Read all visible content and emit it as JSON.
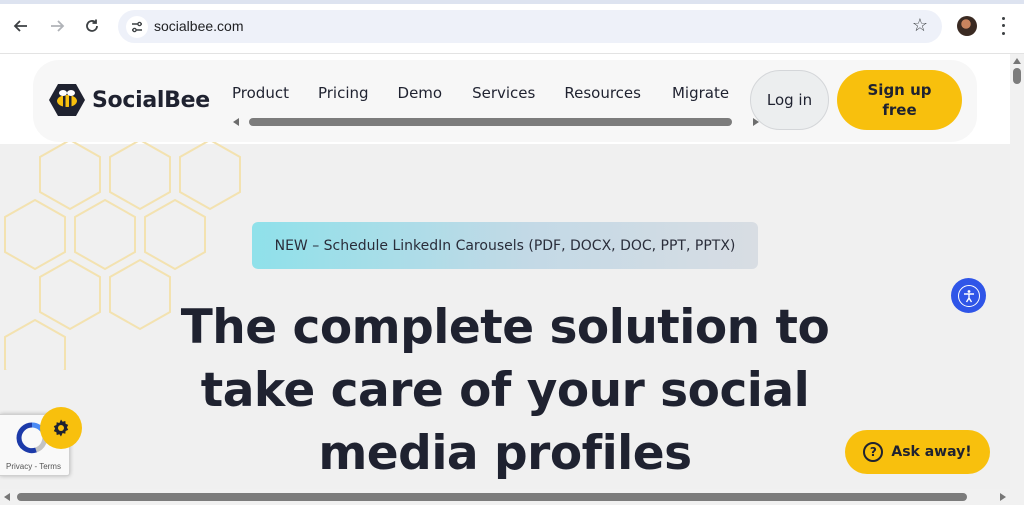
{
  "browser": {
    "url": "socialbee.com",
    "icons": [
      "back-arrow-icon",
      "forward-arrow-icon",
      "reload-icon",
      "site-info-icon",
      "bookmark-star-icon",
      "profile-avatar",
      "more-menu-icon"
    ]
  },
  "site": {
    "logo_text": "SocialBee",
    "nav": [
      {
        "label": "Product"
      },
      {
        "label": "Pricing"
      },
      {
        "label": "Demo"
      },
      {
        "label": "Services"
      },
      {
        "label": "Resources"
      },
      {
        "label": "Migrate"
      }
    ],
    "login_label": "Log in",
    "signup_label": "Sign up free",
    "accent_color": "#f8c00d"
  },
  "hero": {
    "badge": "NEW – Schedule LinkedIn Carousels (PDF, DOCX, DOC, PPT, PPTX)",
    "title_lines": [
      "The complete solution to",
      "take care of your social",
      "media profiles"
    ]
  },
  "widgets": {
    "ask_label": "Ask away!",
    "recaptcha_terms": "Privacy - Terms",
    "accessibility_color": "#2f55e8"
  }
}
